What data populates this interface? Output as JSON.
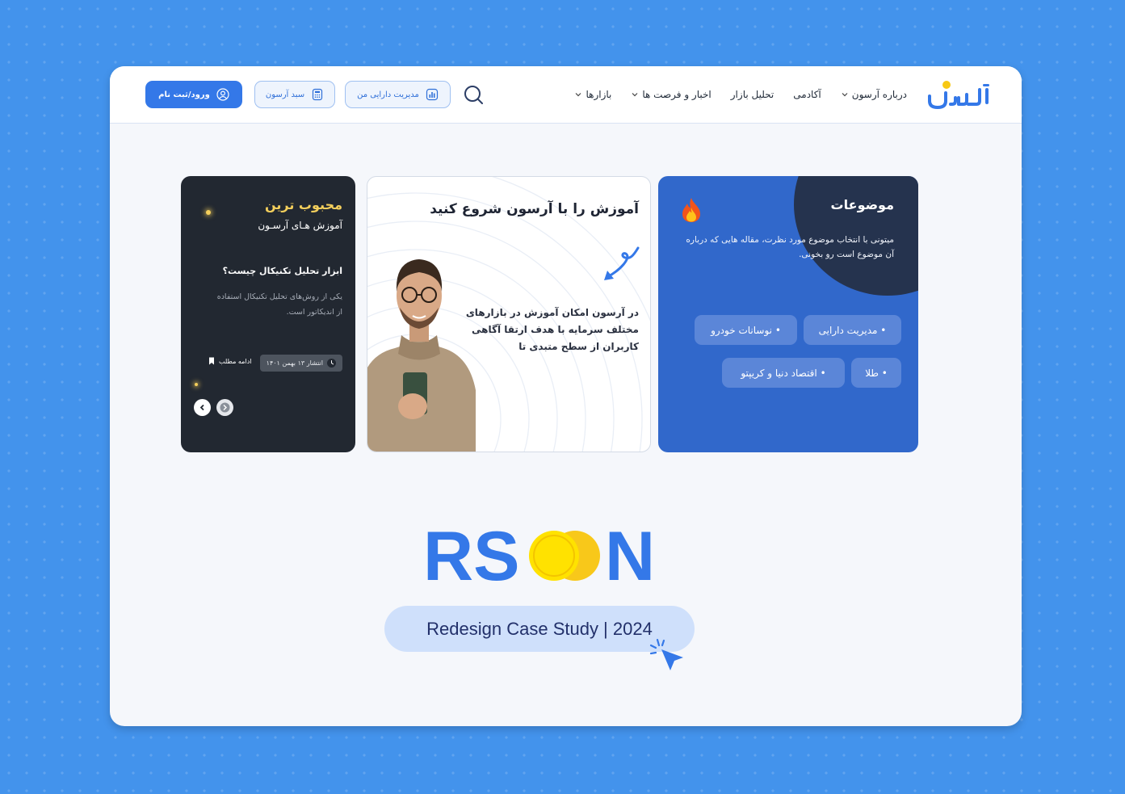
{
  "header": {
    "logo_text": "آرسون",
    "nav": [
      {
        "label": "بازارها",
        "has_dropdown": true
      },
      {
        "label": "اخبار و فرصت ها",
        "has_dropdown": true
      },
      {
        "label": "تحلیل بازار",
        "has_dropdown": false
      },
      {
        "label": "آکادمی",
        "has_dropdown": false
      },
      {
        "label": "درباره آرسون",
        "has_dropdown": true
      }
    ],
    "search_icon": "search-icon",
    "assets_button": "مدیریت دارایی من",
    "cart_button": "سبد آرسون",
    "login_button": "ورود/ثبت نام"
  },
  "topics": {
    "title": "موضوعات",
    "description": "میتونی با انتخاب موضوع مورد نظرت، مقاله هایی که درباره آن موضوع است رو بخونی.",
    "chips": [
      "• مدیریت دارایی",
      "• نوسانات خودرو",
      "• طلا",
      "• اقتصاد دنیا و کریپتو"
    ]
  },
  "learn": {
    "title": "آموزش را با آرسون شروع کنید",
    "body": "در آرسون امکان آموزش در بازارهای مختلف سرمایه با هدف ارتقا آگاهی کاربران از سطح متبدی تا"
  },
  "popular": {
    "title": "محبوب ترین",
    "subtitle": "آموزش هـای آرسـون",
    "article_title": "ابزار تحلیل تکنیکال چیست؟",
    "article_excerpt": "یکی از روش‌های تحلیل تکنیکال استفاده از اندیکاتور است.",
    "date": "انتشار ۱۳ بهمن ۱۴۰۱",
    "read_more": "ادامه مطلب"
  },
  "branding": {
    "wordmark_left": "RS",
    "wordmark_right": "N",
    "case_study": "Redesign Case Study | 2024"
  },
  "colors": {
    "background": "#4393ec",
    "primary": "#3478e8",
    "topics_card": "#3168cb",
    "dark_card": "#222831",
    "gold": "#f4cf5c",
    "brand_yellow": "#ffe200"
  }
}
